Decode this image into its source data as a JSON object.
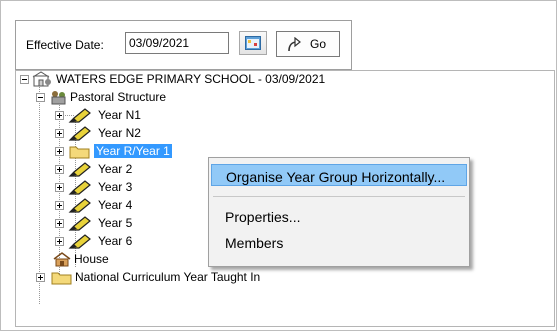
{
  "toolbar": {
    "effective_date_label": "Effective Date:",
    "effective_date_value": "03/09/2021",
    "go_label": "Go"
  },
  "tree": {
    "root": "WATERS EDGE PRIMARY SCHOOL - 03/09/2021",
    "pastoral": "Pastoral Structure",
    "years": [
      "Year N1",
      "Year N2",
      "Year R/Year 1",
      "Year 2",
      "Year 3",
      "Year 4",
      "Year 5",
      "Year 6"
    ],
    "house": "House",
    "nc_year": "National Curriculum Year Taught In"
  },
  "context_menu": {
    "items": [
      "Organise Year Group Horizontally...",
      "Properties...",
      "Members"
    ]
  },
  "colors": {
    "selection": "#3399ff",
    "menu_highlight": "#91c9f7"
  }
}
